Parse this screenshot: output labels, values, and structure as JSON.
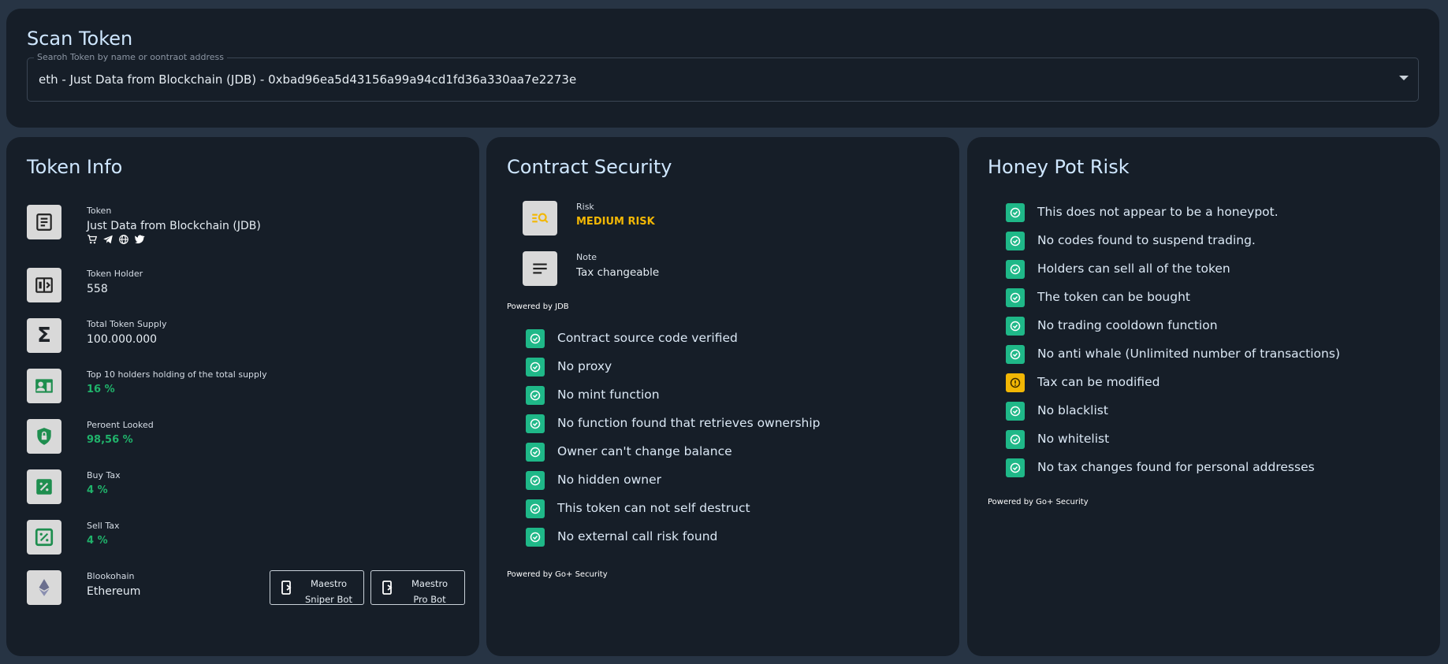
{
  "scan": {
    "title": "Scan Token",
    "search_label": "Searoh Token by name or oontraot address",
    "search_value": "eth - Just Data from Blockchain (JDB) - 0xbad96ea5d43156a99a94cd1fd36a330aa7e2273e"
  },
  "token_info": {
    "title": "Token Info",
    "rows": [
      {
        "label": "Token",
        "value": "Just Data from Blockchain (JDB)",
        "icon": "document-icon"
      },
      {
        "label": "Token Holder",
        "value": "558",
        "icon": "holder-icon"
      },
      {
        "label": "Total Token Supply",
        "value": "100.000.000",
        "icon": "sigma-icon"
      },
      {
        "label": "Top 10 holders holding of the total supply",
        "value": "16 %",
        "icon": "person-card-icon"
      },
      {
        "label": "Peroent Looked",
        "value": "98,56 %",
        "icon": "shield-lock-icon"
      },
      {
        "label": "Buy Tax",
        "value": "4 %",
        "icon": "percent-icon"
      },
      {
        "label": "Sell Tax",
        "value": "4 %",
        "icon": "percent-box-icon"
      },
      {
        "label": "Blookohain",
        "value": "Ethereum",
        "icon": "ethereum-icon"
      }
    ],
    "social_icons": [
      "cart-icon",
      "telegram-icon",
      "globe-icon",
      "twitter-icon"
    ],
    "bots": [
      {
        "line1": "Maestro",
        "line2": "Sniper Bot"
      },
      {
        "line1": "Maestro",
        "line2": "Pro Bot"
      }
    ]
  },
  "contract": {
    "title": "Contract Security",
    "risk_label": "Risk",
    "risk_value": "MEDIUM RISK",
    "note_label": "Note",
    "note_value": "Tax changeable",
    "powered_jdb": "Powered by JDB",
    "checks": [
      "Contract source code verified",
      "No proxy",
      "No mint function",
      "No function found that retrieves ownership",
      "Owner can't change balance",
      "No hidden owner",
      "This token can not self destruct",
      "No external call risk found"
    ],
    "powered_go": "Powered by Go+ Security"
  },
  "honeypot": {
    "title": "Honey Pot Risk",
    "checks": [
      {
        "text": "This does not appear to be a honeypot.",
        "status": "ok"
      },
      {
        "text": "No codes found to suspend trading.",
        "status": "ok"
      },
      {
        "text": "Holders can sell all of the token",
        "status": "ok"
      },
      {
        "text": "The token can be bought",
        "status": "ok"
      },
      {
        "text": "No trading cooldown function",
        "status": "ok"
      },
      {
        "text": "No anti whale (Unlimited number of transactions)",
        "status": "ok"
      },
      {
        "text": "Tax can be modified",
        "status": "warn"
      },
      {
        "text": "No blacklist",
        "status": "ok"
      },
      {
        "text": "No whitelist",
        "status": "ok"
      },
      {
        "text": "No tax changes found for personal addresses",
        "status": "ok"
      }
    ],
    "powered_go": "Powered by Go+ Security"
  },
  "colors": {
    "background": "#273444",
    "card": "#161e28",
    "ok": "#1fb888",
    "warn": "#f2b705",
    "green_value": "#20b36b"
  }
}
